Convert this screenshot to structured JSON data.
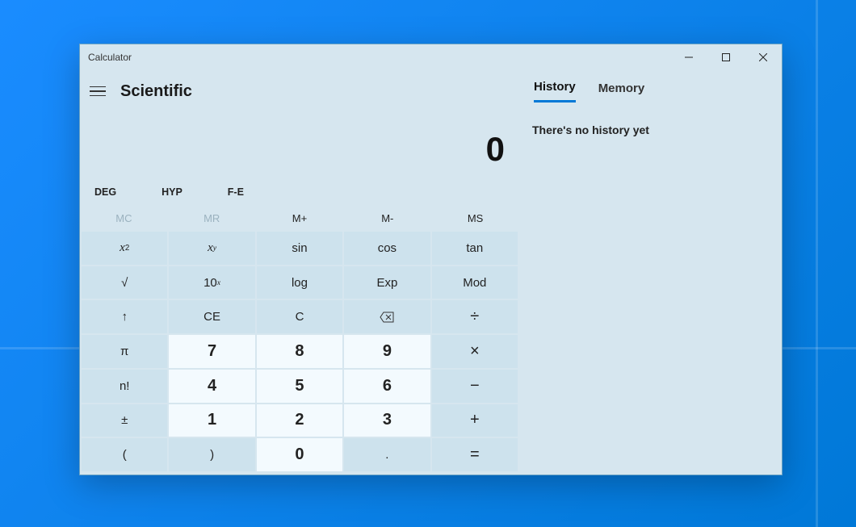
{
  "window": {
    "title": "Calculator"
  },
  "header": {
    "mode": "Scientific"
  },
  "display": {
    "value": "0"
  },
  "toggles": {
    "deg": "DEG",
    "hyp": "HYP",
    "fe": "F-E"
  },
  "memory": {
    "mc": "MC",
    "mr": "MR",
    "mplus": "M+",
    "mminus": "M-",
    "ms": "MS"
  },
  "tabs": {
    "history": "History",
    "memory": "Memory"
  },
  "history": {
    "empty": "There's no history yet"
  },
  "keys": {
    "xsq_base": "x",
    "xsq_sup": "2",
    "xy_base": "x",
    "xy_sup": "y",
    "sin": "sin",
    "cos": "cos",
    "tan": "tan",
    "sqrt": "√",
    "tenx_base": "10",
    "tenx_sup": "x",
    "log": "log",
    "exp": "Exp",
    "mod": "Mod",
    "up": "↑",
    "ce": "CE",
    "c": "C",
    "back": "⌫",
    "div": "÷",
    "pi": "π",
    "mul": "×",
    "fact": "n!",
    "sub": "−",
    "pm": "±",
    "add": "+",
    "lp": "(",
    "rp": ")",
    "dot": ".",
    "eq": "=",
    "n0": "0",
    "n1": "1",
    "n2": "2",
    "n3": "3",
    "n4": "4",
    "n5": "5",
    "n6": "6",
    "n7": "7",
    "n8": "8",
    "n9": "9"
  }
}
